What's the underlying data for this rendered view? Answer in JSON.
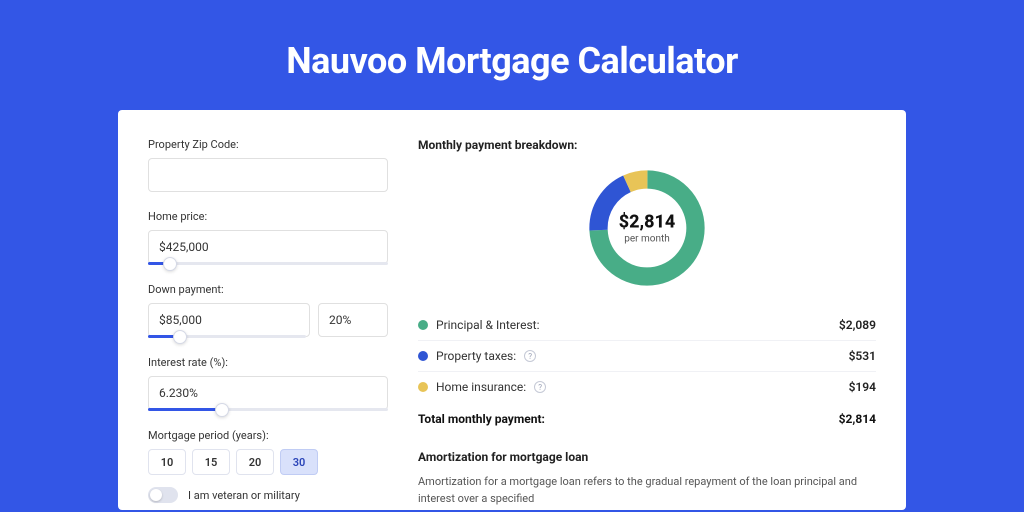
{
  "page": {
    "title": "Nauvoo Mortgage Calculator"
  },
  "form": {
    "zip": {
      "label": "Property Zip Code:",
      "value": ""
    },
    "price": {
      "label": "Home price:",
      "value": "$425,000",
      "slider_pct": 9
    },
    "down": {
      "label": "Down payment:",
      "amount": "$85,000",
      "percent": "20%",
      "slider_pct": 20
    },
    "rate": {
      "label": "Interest rate (%):",
      "value": "6.230%",
      "slider_pct": 31
    },
    "period": {
      "label": "Mortgage period (years):",
      "options": [
        "10",
        "15",
        "20",
        "30"
      ],
      "selected": "30"
    },
    "veteran": {
      "label": "I am veteran or military",
      "on": false
    }
  },
  "breakdown": {
    "title": "Monthly payment breakdown:",
    "center_amount": "$2,814",
    "center_sub": "per month",
    "items": [
      {
        "label": "Principal & Interest:",
        "value": "$2,089",
        "color": "green",
        "help": false
      },
      {
        "label": "Property taxes:",
        "value": "$531",
        "color": "blue",
        "help": true
      },
      {
        "label": "Home insurance:",
        "value": "$194",
        "color": "yellow",
        "help": true
      }
    ],
    "total_label": "Total monthly payment:",
    "total_value": "$2,814"
  },
  "amort": {
    "title": "Amortization for mortgage loan",
    "text": "Amortization for a mortgage loan refers to the gradual repayment of the loan principal and interest over a specified"
  },
  "chart_data": {
    "type": "pie",
    "title": "Monthly payment breakdown",
    "series": [
      {
        "name": "Principal & Interest",
        "value": 2089,
        "color": "#48ad87"
      },
      {
        "name": "Property taxes",
        "value": 531,
        "color": "#2f55d4"
      },
      {
        "name": "Home insurance",
        "value": 194,
        "color": "#e8c457"
      }
    ],
    "total": 2814,
    "unit": "USD per month"
  }
}
